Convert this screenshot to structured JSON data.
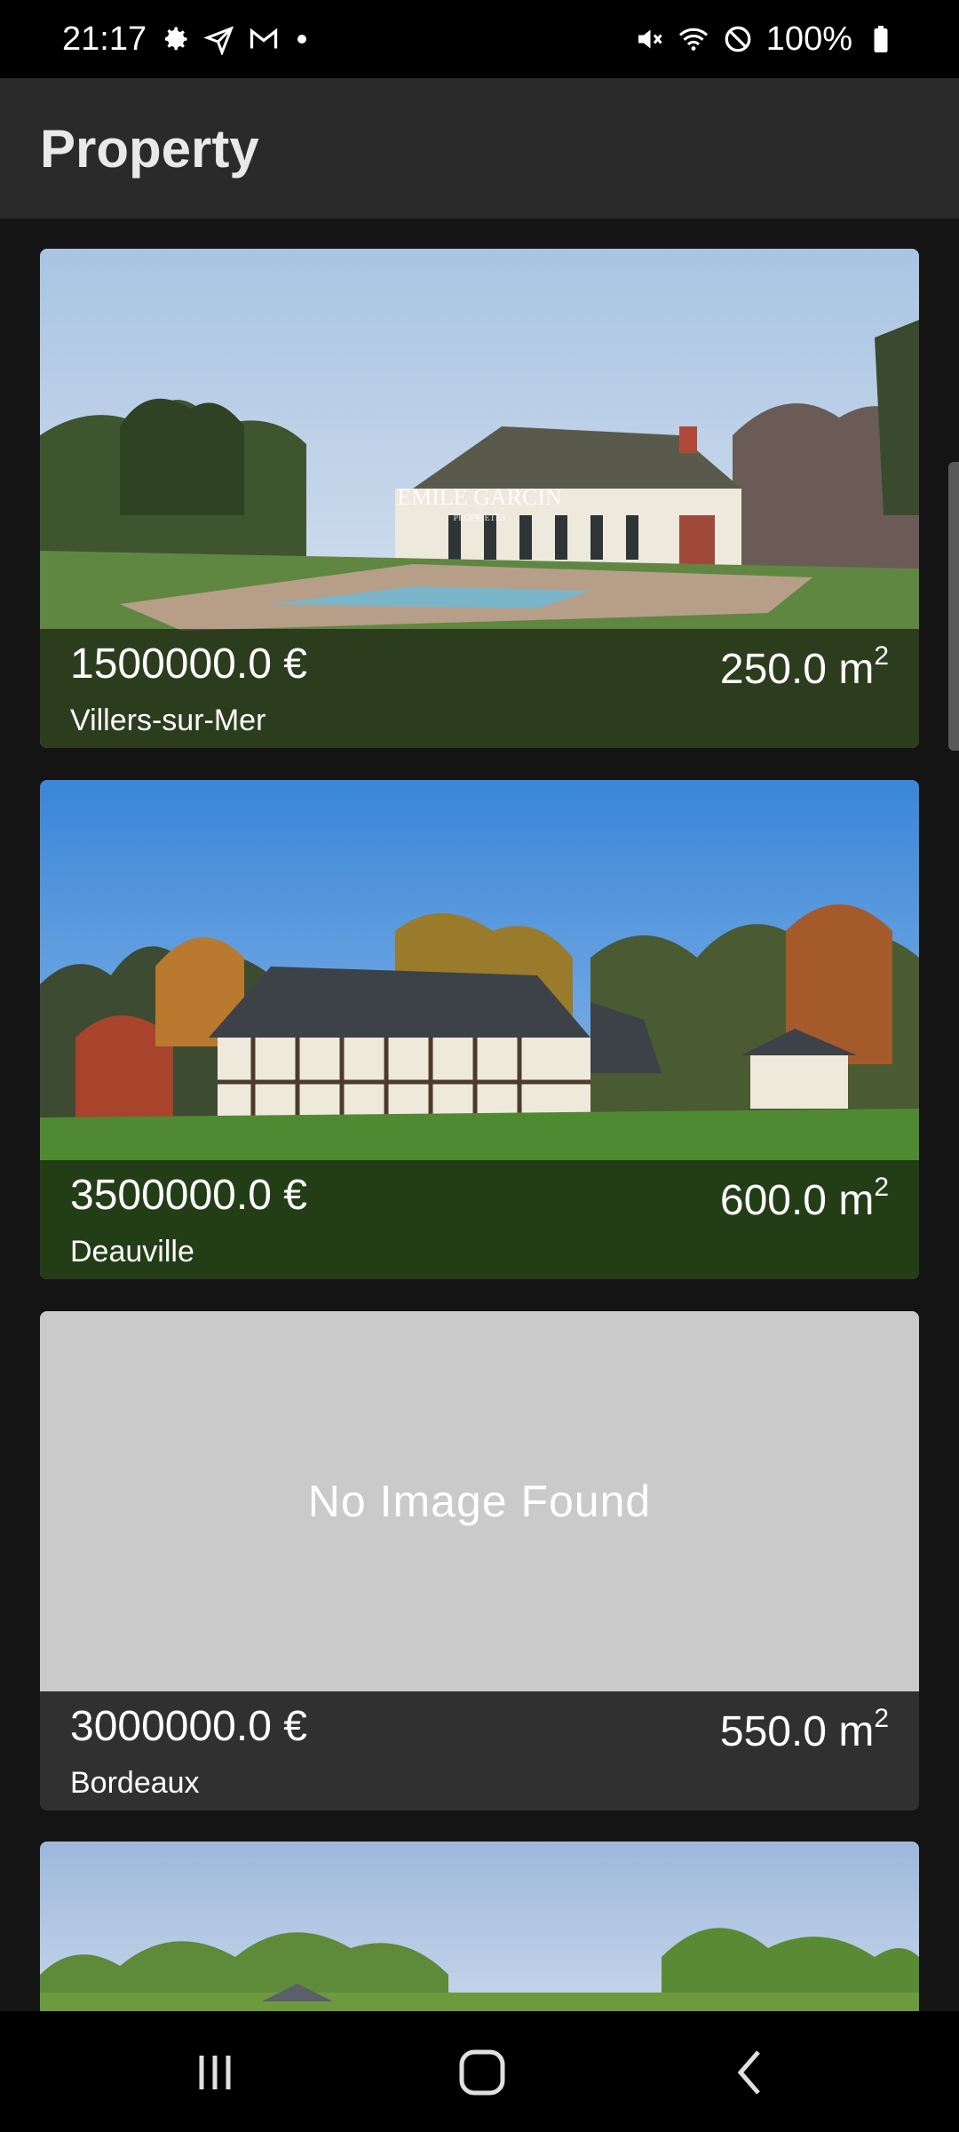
{
  "status_bar": {
    "time": "21:17",
    "battery": "100%",
    "left_icons": [
      "gear-icon",
      "paper-plane-icon",
      "gmail-icon",
      "dot-icon"
    ],
    "right_icons": [
      "mute-icon",
      "wifi-icon",
      "block-icon",
      "battery-icon"
    ]
  },
  "app_bar": {
    "title": "Property"
  },
  "properties": [
    {
      "price": "1500000.0 €",
      "city": "Villers-sur-Mer",
      "area": "250.0 m",
      "area_sup": "2",
      "watermark": "EMILE GARCIN",
      "watermark_sub": "PROPRIÉTÉS"
    },
    {
      "price": "3500000.0 €",
      "city": "Deauville",
      "area": "600.0 m",
      "area_sup": "2"
    },
    {
      "price": "3000000.0 €",
      "city": "Bordeaux",
      "area": "550.0 m",
      "area_sup": "2",
      "no_image_text": "No Image Found"
    }
  ],
  "nav_bar": {
    "buttons": [
      "recents-icon",
      "home-icon",
      "back-icon"
    ]
  },
  "colors": {
    "background": "#141414",
    "app_bar": "#2a2a2a",
    "placeholder": "#cacaca"
  }
}
